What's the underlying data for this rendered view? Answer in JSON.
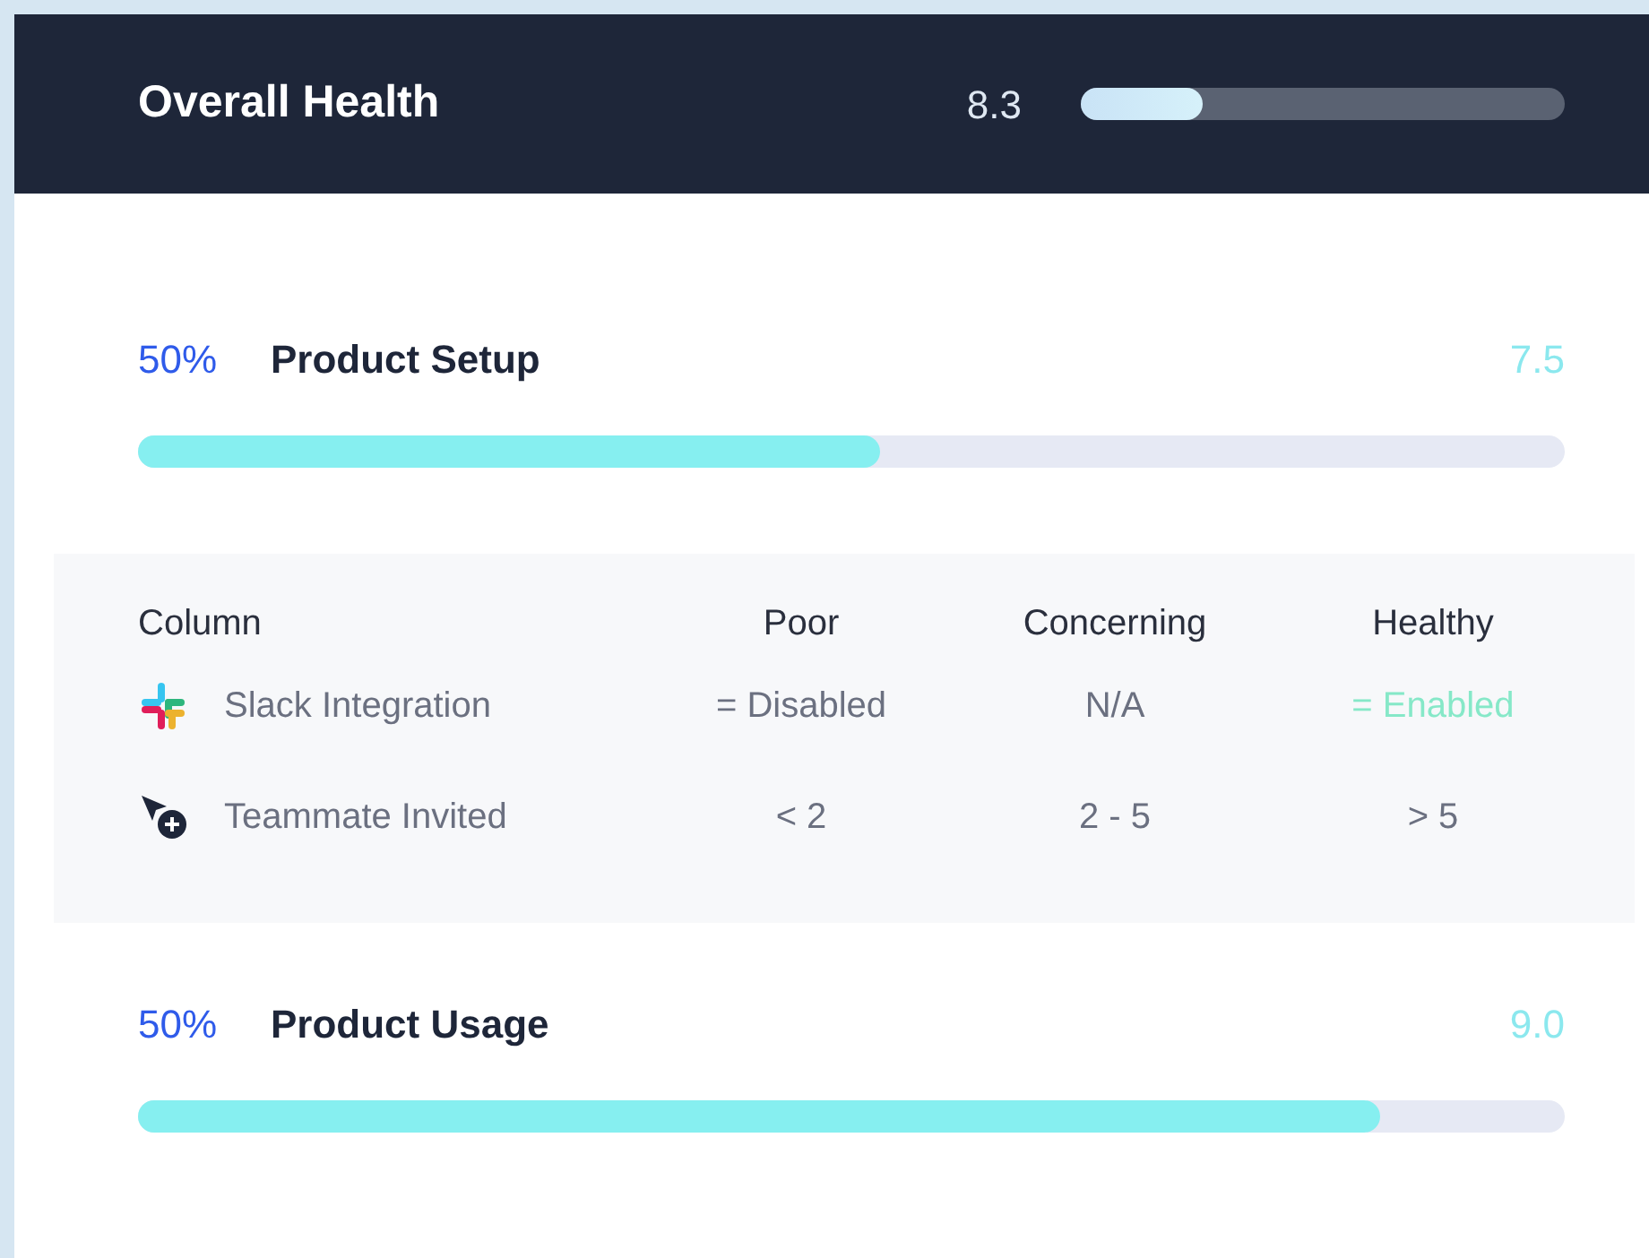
{
  "header": {
    "title": "Overall Health",
    "score": "8.3",
    "level": 0.25
  },
  "sections": [
    {
      "percent": "50%",
      "title": "Product Setup",
      "score": "7.5",
      "level": 0.52,
      "table": {
        "columns": [
          "Column",
          "Poor",
          "Concerning",
          "Healthy"
        ],
        "rows": [
          {
            "kind": "slack",
            "cells": [
              {
                "text": "Slack Integration",
                "kind": "label"
              },
              {
                "text": "= Disabled",
                "kind": "plain"
              },
              {
                "text": "N/A",
                "kind": "plain"
              },
              {
                "text": "= Enabled",
                "kind": "match"
              }
            ]
          },
          {
            "kind": "cursor",
            "cells": [
              {
                "text": "Teammate Invited",
                "kind": "label"
              },
              {
                "text": "< 2",
                "kind": "plain"
              },
              {
                "text": "2 - 5",
                "kind": "plain"
              },
              {
                "text": "> 5",
                "kind": "plain"
              }
            ]
          }
        ]
      }
    },
    {
      "percent": "50%",
      "title": "Product Usage",
      "score": "9.0",
      "level": 0.87
    }
  ]
}
